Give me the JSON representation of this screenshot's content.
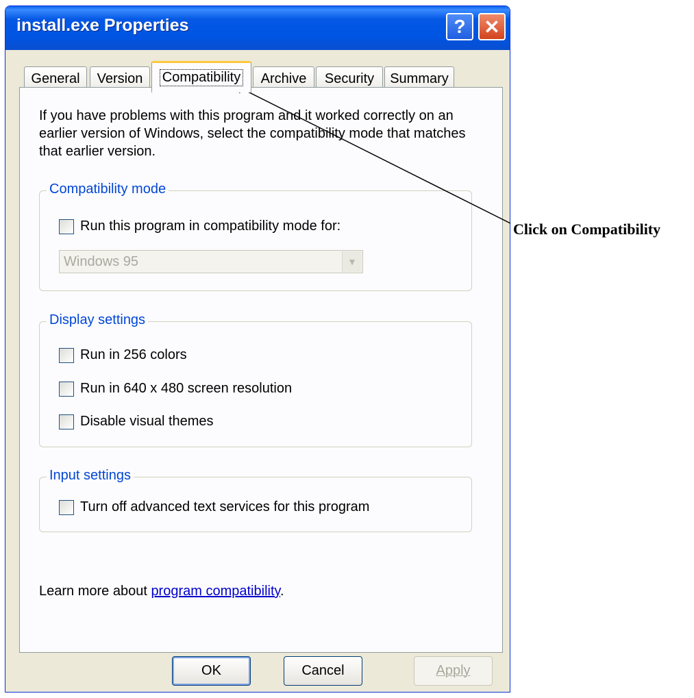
{
  "window": {
    "title": "install.exe Properties",
    "help_label": "?",
    "close_label": "✕"
  },
  "tabs": [
    {
      "label": "General",
      "active": false
    },
    {
      "label": "Version",
      "active": false
    },
    {
      "label": "Compatibility",
      "active": true
    },
    {
      "label": "Archive",
      "active": false
    },
    {
      "label": "Security",
      "active": false
    },
    {
      "label": "Summary",
      "active": false
    }
  ],
  "intro_text": "If you have problems with this program and it worked correctly on an earlier version of Windows, select the compatibility mode that matches that earlier version.",
  "compatibility_mode": {
    "legend": "Compatibility mode",
    "checkbox_label": "Run this program in compatibility mode for:",
    "checked": false,
    "select_value": "Windows 95"
  },
  "display_settings": {
    "legend": "Display settings",
    "options": [
      {
        "label": "Run in 256 colors",
        "checked": false
      },
      {
        "label": "Run in 640 x 480 screen resolution",
        "checked": false
      },
      {
        "label": "Disable visual themes",
        "checked": false
      }
    ]
  },
  "input_settings": {
    "legend": "Input settings",
    "options": [
      {
        "label": "Turn off advanced text services for this program",
        "checked": false
      }
    ]
  },
  "learn_more": {
    "prefix": "Learn more about ",
    "link_text": "program compatibility",
    "suffix": "."
  },
  "buttons": {
    "ok": "OK",
    "cancel": "Cancel",
    "apply": "Apply"
  },
  "annotation": {
    "text": "Click on Compatibility"
  },
  "colors": {
    "titlebar": "#0054E3",
    "dialog_bg": "#ECE9D8",
    "group_legend": "#0046D5",
    "active_tab_accent": "#FFC83C"
  }
}
